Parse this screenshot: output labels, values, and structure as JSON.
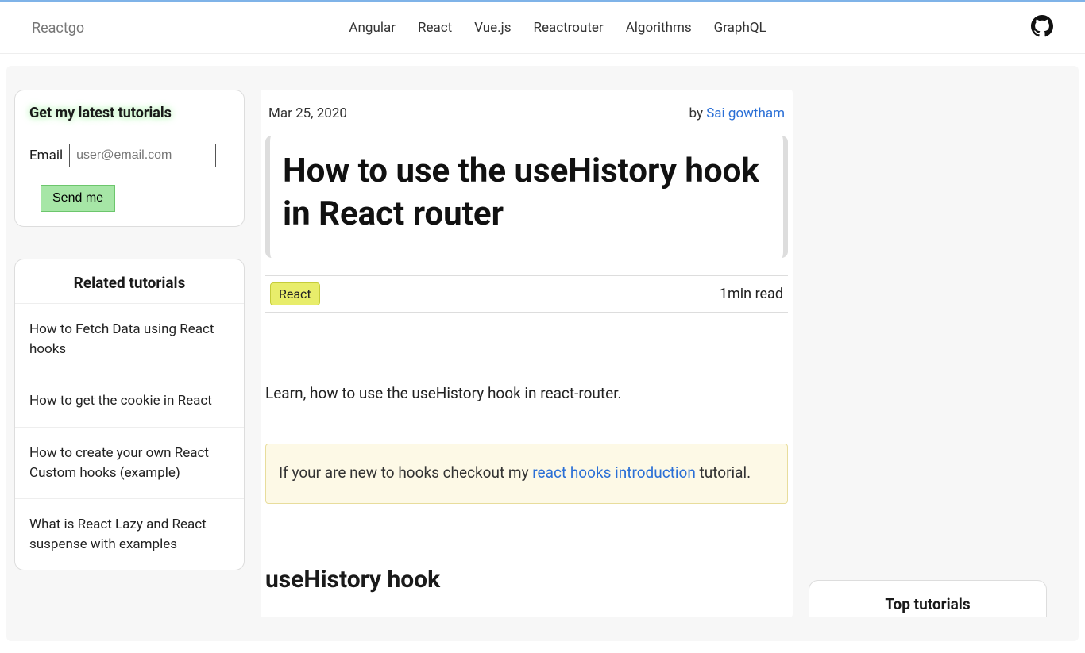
{
  "site": {
    "name": "Reactgo"
  },
  "nav": {
    "items": [
      {
        "label": "Angular"
      },
      {
        "label": "React"
      },
      {
        "label": "Vue.js"
      },
      {
        "label": "Reactrouter"
      },
      {
        "label": "Algorithms"
      },
      {
        "label": "GraphQL"
      }
    ]
  },
  "emailBox": {
    "title": "Get my latest tutorials",
    "label": "Email",
    "placeholder": "user@email.com",
    "button": "Send me"
  },
  "related": {
    "title": "Related tutorials",
    "items": [
      {
        "label": "How to Fetch Data using React hooks"
      },
      {
        "label": "How to get the cookie in React"
      },
      {
        "label": "How to create your own React Custom hooks (example)"
      },
      {
        "label": "What is React Lazy and React suspense with examples"
      }
    ]
  },
  "article": {
    "date": "Mar 25, 2020",
    "byPrefix": "by ",
    "author": "Sai gowtham",
    "title": "How to use the useHistory hook in React router",
    "tag": "React",
    "readTime": "1min read",
    "lead": "Learn, how to use the useHistory hook in react-router.",
    "callout": {
      "before": "If your are new to hooks checkout my ",
      "link": "react hooks introduction",
      "after": " tutorial."
    },
    "sectionHeading": "useHistory hook"
  },
  "topTutorials": {
    "title": "Top tutorials"
  }
}
